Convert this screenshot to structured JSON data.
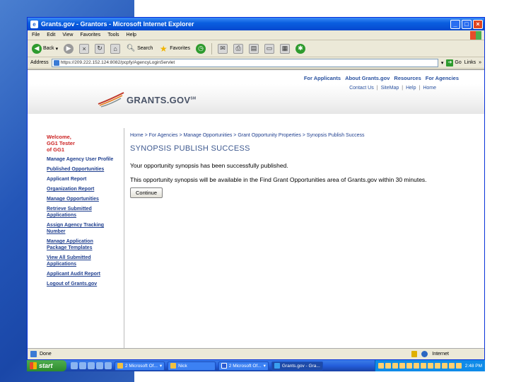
{
  "window": {
    "title": "Grants.gov - Grantors - Microsoft Internet Explorer",
    "menu": [
      "File",
      "Edit",
      "View",
      "Favorites",
      "Tools",
      "Help"
    ],
    "toolbar": {
      "back": "Back",
      "search": "Search",
      "favorites": "Favorites"
    },
    "address": {
      "label": "Address",
      "url": "https://209.222.152.124:8082/pcpfy/AgencyLoginServlet",
      "go": "Go",
      "links": "Links"
    },
    "status": {
      "text": "Done",
      "zone": "Internet"
    }
  },
  "site": {
    "top_nav": [
      "For Applicants",
      "About Grants.gov",
      "Resources",
      "For Agencies"
    ],
    "sub_nav": [
      "Contact Us",
      "SiteMap",
      "Help",
      "Home"
    ],
    "logo": "GRANTS.GOV",
    "logo_tm": "SM"
  },
  "sidebar": {
    "welcome_lines": [
      "Welcome,",
      "GG1 Tester",
      "of GG1"
    ],
    "links": [
      "Manage Agency User Profile",
      "Published Opportunities",
      "Applicant Report",
      "Organization Report",
      "Manage Opportunities",
      "Retrieve Submitted Applications",
      "Assign Agency Tracking Number",
      "Manage Application Package Templates",
      "View All Submitted Applications",
      "Applicant Audit Report",
      "Logout of Grants.gov"
    ]
  },
  "main": {
    "breadcrumb": "Home  > For Agencies  > Manage Opportunities  > Grant Opportunity Properties  > Synopsis Publish Success",
    "title": "SYNOPSIS PUBLISH SUCCESS",
    "message1": "Your opportunity synopsis has been successfully published.",
    "message2": "This opportunity synopsis will be available in the Find Grant Opportunities area of Grants.gov within 30 minutes.",
    "continue": "Continue"
  },
  "taskbar": {
    "start": "start",
    "tasks": [
      "2 Microsoft Of...",
      "Nick",
      "2 Microsoft Of...",
      "Grants.gov - Gra..."
    ],
    "clock": "2:48 PM"
  }
}
